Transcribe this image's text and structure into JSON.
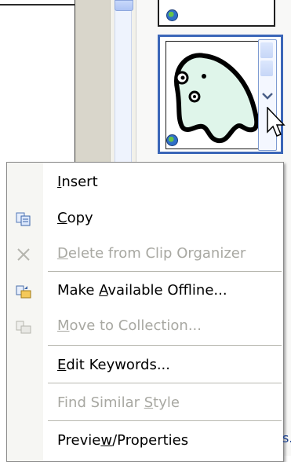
{
  "menu": {
    "items": [
      {
        "id": "insert",
        "label": "Insert",
        "enabled": true,
        "icon": "none"
      },
      {
        "id": "copy",
        "label": "Copy",
        "enabled": true,
        "icon": "copy-icon"
      },
      {
        "id": "delete",
        "label": "Delete from Clip Organizer",
        "enabled": false,
        "icon": "delete-x-icon"
      },
      {
        "id": "offline",
        "label": "Make Available Offline...",
        "enabled": true,
        "icon": "offline-icon"
      },
      {
        "id": "move",
        "label": "Move to Collection...",
        "enabled": false,
        "icon": "move-icon"
      },
      {
        "id": "keywords",
        "label": "Edit Keywords...",
        "enabled": true,
        "icon": "none"
      },
      {
        "id": "similar",
        "label": "Find Similar Style",
        "enabled": false,
        "icon": "none"
      },
      {
        "id": "preview",
        "label": "Preview/Properties",
        "enabled": true,
        "icon": "none"
      }
    ]
  },
  "status": {
    "partial_text": "s."
  },
  "colors": {
    "selection_border": "#3b66b8",
    "disabled_text": "#a8a8a2"
  }
}
